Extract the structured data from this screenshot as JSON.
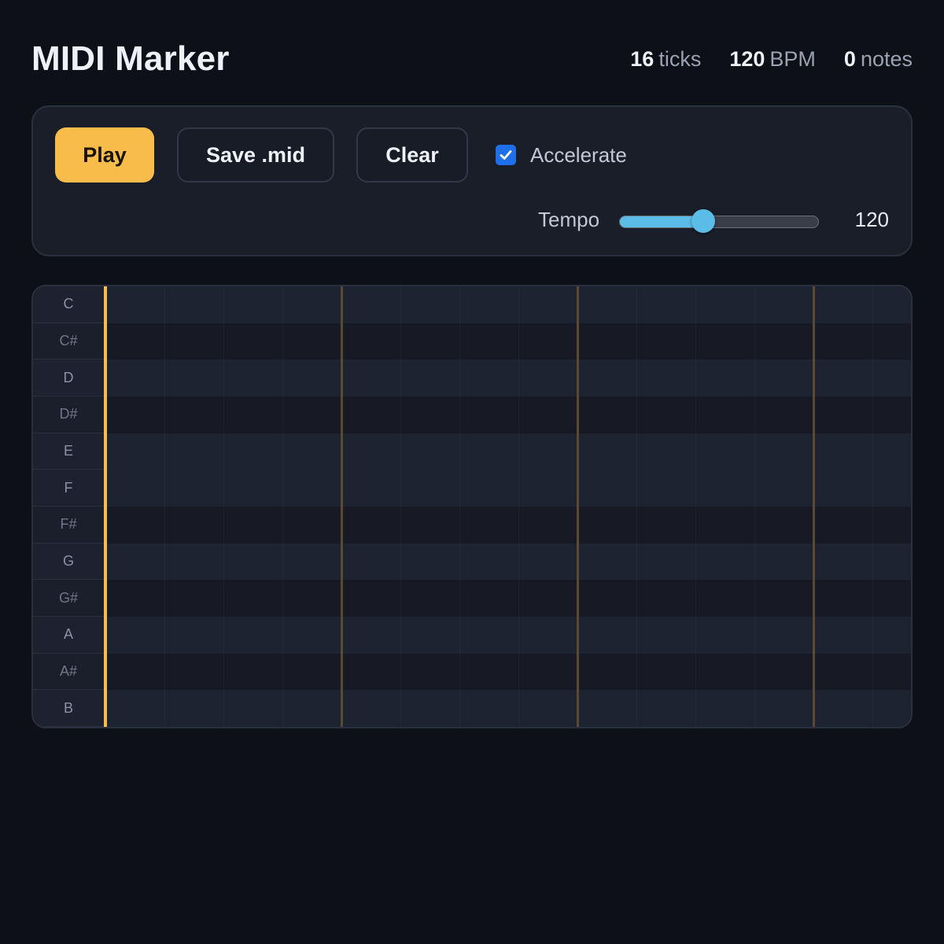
{
  "header": {
    "title": "MIDI Marker",
    "stats": [
      {
        "value": "16",
        "unit": "ticks"
      },
      {
        "value": "120",
        "unit": "BPM"
      },
      {
        "value": "0",
        "unit": "notes"
      }
    ]
  },
  "controls": {
    "play_label": "Play",
    "save_label": "Save .mid",
    "clear_label": "Clear",
    "accelerate_label": "Accelerate",
    "accelerate_checked": true,
    "tempo_label": "Tempo",
    "tempo_value": "120",
    "tempo_fraction": 0.41
  },
  "piano_roll": {
    "keys": [
      "C",
      "C#",
      "D",
      "D#",
      "E",
      "F",
      "F#",
      "G",
      "G#",
      "A",
      "A#",
      "B"
    ],
    "ticks": 16,
    "ticks_per_bar": 4,
    "playhead_tick": 0
  },
  "colors": {
    "accent": "#f7bc49",
    "slider": "#5cbce8",
    "checkbox": "#1f6fe8"
  }
}
